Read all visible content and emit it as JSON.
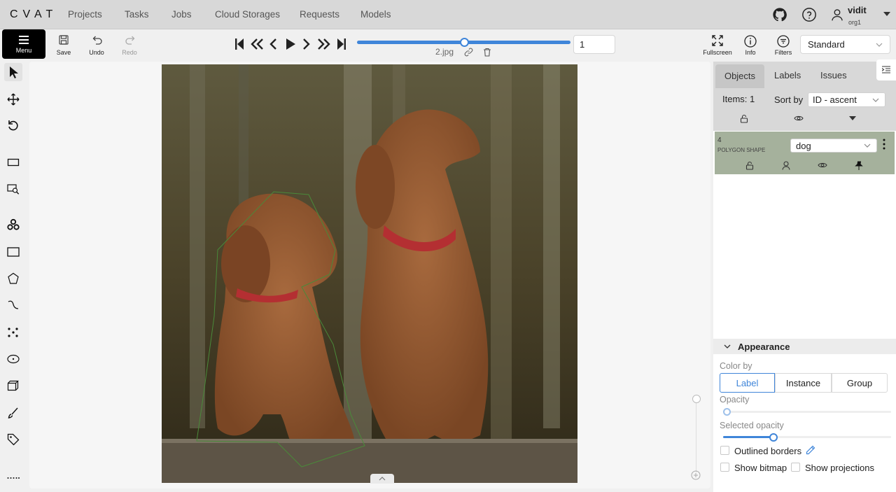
{
  "header": {
    "logo": "CVAT",
    "nav": [
      "Projects",
      "Tasks",
      "Jobs",
      "Cloud Storages",
      "Requests",
      "Models"
    ],
    "user": {
      "name": "vidit",
      "org": "org1"
    }
  },
  "toolbar": {
    "menu_label": "Menu",
    "save_label": "Save",
    "undo_label": "Undo",
    "redo_label": "Redo",
    "frame_number": "1",
    "filename": "2.jpg",
    "frame_progress": 0.5,
    "fullscreen_label": "Fullscreen",
    "info_label": "Info",
    "filters_label": "Filters",
    "workspace": "Standard"
  },
  "sidebar": {
    "tabs": [
      "Objects",
      "Labels",
      "Issues"
    ],
    "items_count": "Items: 1",
    "sort_by_label": "Sort by",
    "sort_value": "ID - ascent",
    "object": {
      "id": "4",
      "type": "POLYGON SHAPE",
      "label": "dog",
      "color": "#a5b19c"
    },
    "appearance": {
      "title": "Appearance",
      "color_by_label": "Color by",
      "color_by_options": [
        "Label",
        "Instance",
        "Group"
      ],
      "color_by_selected": "Label",
      "opacity_label": "Opacity",
      "opacity_value": 0,
      "selected_opacity_label": "Selected opacity",
      "selected_opacity_value": 0.3,
      "outlined_borders_label": "Outlined borders",
      "show_bitmap_label": "Show bitmap",
      "show_projections_label": "Show projections"
    }
  },
  "colors": {
    "accent": "#3f85d9",
    "header_bg": "#d8d8d8",
    "polygon_stroke": "#4a8a3a"
  }
}
